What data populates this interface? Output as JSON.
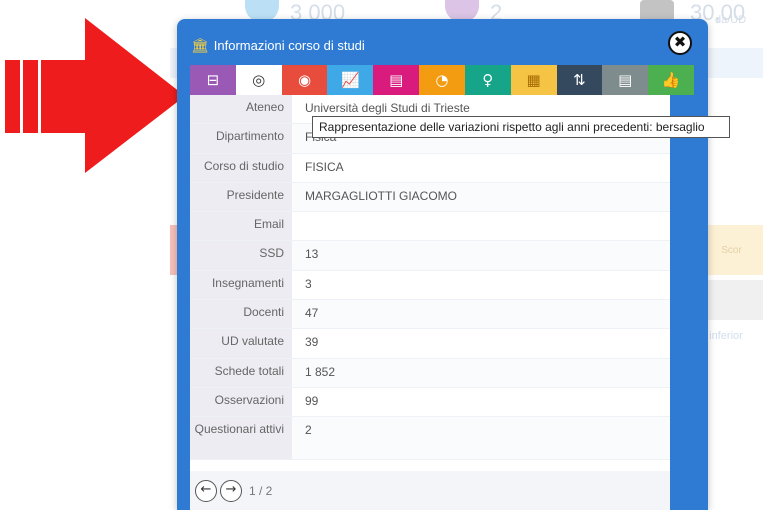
{
  "background": {
    "stat1": "3 000",
    "stat2": "2",
    "stat3": "30,00",
    "stat3_sub": "da/UD",
    "card_label": "Scor",
    "link_text": "o inferior"
  },
  "modal": {
    "title": "Informazioni corso di studi",
    "title_icon": "institution-icon",
    "close_symbol": "✖",
    "tooltip": "Rappresentazione delle variazioni rispetto agli anni precedenti: bersaglio"
  },
  "toolbar": [
    {
      "icon": "presentation-icon",
      "glyph": "⊟",
      "color": "#9b59b6"
    },
    {
      "icon": "target-icon",
      "glyph": "◎",
      "color": "#ffffff",
      "fg": "#333333"
    },
    {
      "icon": "bullseye-icon",
      "glyph": "◉",
      "color": "#e74c3c"
    },
    {
      "icon": "line-chart-icon",
      "glyph": "📈",
      "color": "#3fa9e8"
    },
    {
      "icon": "list-icon",
      "glyph": "▤",
      "color": "#d81b7d"
    },
    {
      "icon": "gauge-icon",
      "glyph": "◔",
      "color": "#f39c12"
    },
    {
      "icon": "lightbulb-icon",
      "glyph": "♀",
      "color": "#17a589"
    },
    {
      "icon": "table-icon",
      "glyph": "▦",
      "color": "#f6c445",
      "fg": "#a66b00"
    },
    {
      "icon": "sort-icon",
      "glyph": "⇅",
      "color": "#34495e"
    },
    {
      "icon": "list-alt-icon",
      "glyph": "▤",
      "color": "#7f8c8d"
    },
    {
      "icon": "thumbs-up-icon",
      "glyph": "👍",
      "color": "#4caf50"
    }
  ],
  "rows": [
    {
      "label": "Ateneo",
      "value": "Università degli Studi di Trieste"
    },
    {
      "label": "Dipartimento",
      "value": "Fisica"
    },
    {
      "label": "Corso di studio",
      "value": "FISICA"
    },
    {
      "label": "Presidente",
      "value": "MARGAGLIOTTI GIACOMO"
    },
    {
      "label": "Email",
      "value": ""
    },
    {
      "label": "SSD",
      "value": "13"
    },
    {
      "label": "Insegnamenti",
      "value": "3"
    },
    {
      "label": "Docenti",
      "value": "47"
    },
    {
      "label": "UD valutate",
      "value": "39"
    },
    {
      "label": "Schede totali",
      "value": "1 852"
    },
    {
      "label": "Osservazioni",
      "value": "99"
    },
    {
      "label": "Questionari attivi",
      "value": "2"
    }
  ],
  "footer": {
    "prev_symbol": "←",
    "next_symbol": "→",
    "page_indicator": "1 / 2"
  },
  "colors": {
    "modal_blue": "#2f7bd4",
    "arrow_red": "#ee1c1c"
  }
}
